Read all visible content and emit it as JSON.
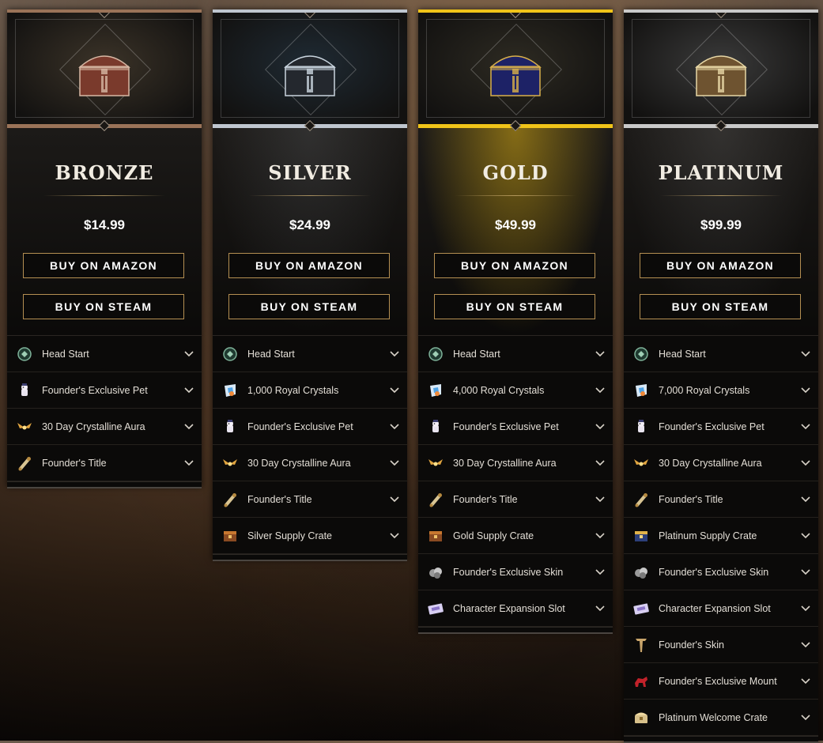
{
  "tiers": [
    {
      "name": "BRONZE",
      "price": "$14.99",
      "accent": "#9a7358",
      "art_tint": "#3b3328",
      "chest_color": "#7a3a2c",
      "chest_trim": "#d7b8a4",
      "head_glow": "rgba(120,95,70,0.0)",
      "amazon_label": "BUY ON AMAZON",
      "steam_label": "BUY ON STEAM",
      "items": [
        {
          "icon": "head-start-icon",
          "label": "Head Start"
        },
        {
          "icon": "pet-icon",
          "label": "Founder's Exclusive Pet"
        },
        {
          "icon": "aura-icon",
          "label": "30 Day Crystalline Aura"
        },
        {
          "icon": "title-scroll-icon",
          "label": "Founder's Title"
        }
      ]
    },
    {
      "name": "SILVER",
      "price": "$24.99",
      "accent": "#bfc6cf",
      "art_tint": "#1f2a33",
      "chest_color": "#24282e",
      "chest_trim": "#c9d4de",
      "head_glow": "rgba(200,210,220,0.12)",
      "amazon_label": "BUY ON AMAZON",
      "steam_label": "BUY ON STEAM",
      "items": [
        {
          "icon": "head-start-icon",
          "label": "Head Start"
        },
        {
          "icon": "royal-crystals-icon",
          "label": "1,000 Royal Crystals"
        },
        {
          "icon": "pet-icon",
          "label": "Founder's Exclusive Pet"
        },
        {
          "icon": "aura-icon",
          "label": "30 Day Crystalline Aura"
        },
        {
          "icon": "title-scroll-icon",
          "label": "Founder's Title"
        },
        {
          "icon": "supply-crate-icon",
          "label": "Silver Supply Crate"
        }
      ]
    },
    {
      "name": "GOLD",
      "price": "$49.99",
      "accent": "#f0c419",
      "art_tint": "#2d2a22",
      "chest_color": "#1d2266",
      "chest_trim": "#d9b04a",
      "head_glow": "rgba(220,175,20,0.55)",
      "amazon_label": "BUY ON AMAZON",
      "steam_label": "BUY ON STEAM",
      "items": [
        {
          "icon": "head-start-icon",
          "label": "Head Start"
        },
        {
          "icon": "royal-crystals-icon",
          "label": "4,000 Royal Crystals"
        },
        {
          "icon": "pet-icon",
          "label": "Founder's Exclusive Pet"
        },
        {
          "icon": "aura-icon",
          "label": "30 Day Crystalline Aura"
        },
        {
          "icon": "title-scroll-icon",
          "label": "Founder's Title"
        },
        {
          "icon": "supply-crate-icon",
          "label": "Gold Supply Crate"
        },
        {
          "icon": "skin-icon",
          "label": "Founder's Exclusive Skin"
        },
        {
          "icon": "expansion-ticket-icon",
          "label": "Character Expansion Slot"
        }
      ]
    },
    {
      "name": "PLATINUM",
      "price": "$99.99",
      "accent": "#c9c9c9",
      "art_tint": "#3a3a3a",
      "chest_color": "#6e5330",
      "chest_trim": "#e7d7a6",
      "head_glow": "rgba(220,220,220,0.12)",
      "amazon_label": "BUY ON AMAZON",
      "steam_label": "BUY ON STEAM",
      "items": [
        {
          "icon": "head-start-icon",
          "label": "Head Start"
        },
        {
          "icon": "royal-crystals-icon",
          "label": "7,000 Royal Crystals"
        },
        {
          "icon": "pet-icon",
          "label": "Founder's Exclusive Pet"
        },
        {
          "icon": "aura-icon",
          "label": "30 Day Crystalline Aura"
        },
        {
          "icon": "title-scroll-icon",
          "label": "Founder's Title"
        },
        {
          "icon": "platinum-crate-icon",
          "label": "Platinum Supply Crate"
        },
        {
          "icon": "skin-icon",
          "label": "Founder's Exclusive Skin"
        },
        {
          "icon": "expansion-ticket-icon",
          "label": "Character Expansion Slot"
        },
        {
          "icon": "founders-skin-icon",
          "label": "Founder's Skin"
        },
        {
          "icon": "mount-icon",
          "label": "Founder's Exclusive Mount"
        },
        {
          "icon": "welcome-crate-icon",
          "label": "Platinum Welcome Crate"
        }
      ]
    }
  ]
}
